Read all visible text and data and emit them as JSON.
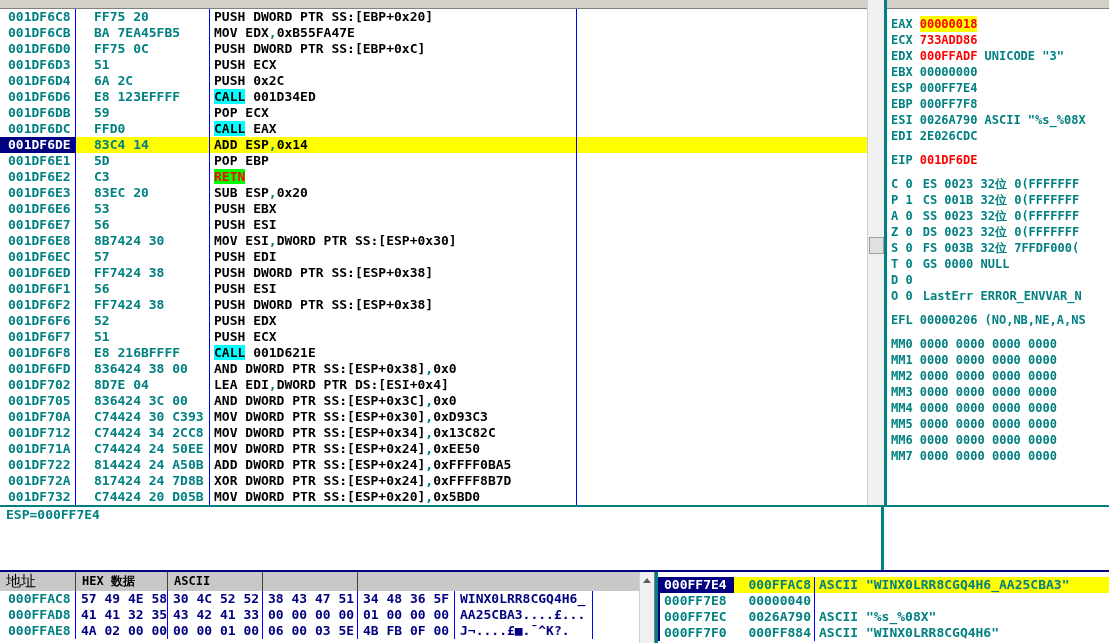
{
  "disasm": {
    "rows": [
      {
        "address": "001DF6C8",
        "hex": "FF75 20",
        "mnemonic": "PUSH",
        "operands": "DWORD PTR SS:[EBP+0x20]",
        "kind": "normal",
        "selected": false
      },
      {
        "address": "001DF6CB",
        "hex": "BA 7EA45FB5",
        "mnemonic": "MOV",
        "operands": "EDX,0xB55FA47E",
        "kind": "normal",
        "selected": false
      },
      {
        "address": "001DF6D0",
        "hex": "FF75 0C",
        "mnemonic": "PUSH",
        "operands": "DWORD PTR SS:[EBP+0xC]",
        "kind": "normal",
        "selected": false
      },
      {
        "address": "001DF6D3",
        "hex": "51",
        "mnemonic": "PUSH",
        "operands": "ECX",
        "kind": "normal",
        "selected": false
      },
      {
        "address": "001DF6D4",
        "hex": "6A 2C",
        "mnemonic": "PUSH",
        "operands": "0x2C",
        "kind": "normal",
        "selected": false
      },
      {
        "address": "001DF6D6",
        "hex": "E8 123EFFFF",
        "mnemonic": "CALL",
        "operands": "001D34ED",
        "kind": "call",
        "selected": false
      },
      {
        "address": "001DF6DB",
        "hex": "59",
        "mnemonic": "POP",
        "operands": "ECX",
        "kind": "normal",
        "selected": false
      },
      {
        "address": "001DF6DC",
        "hex": "FFD0",
        "mnemonic": "CALL",
        "operands": "EAX",
        "kind": "call",
        "selected": false
      },
      {
        "address": "001DF6DE",
        "hex": "83C4 14",
        "mnemonic": "ADD",
        "operands": "ESP,0x14",
        "kind": "normal",
        "selected": true
      },
      {
        "address": "001DF6E1",
        "hex": "5D",
        "mnemonic": "POP",
        "operands": "EBP",
        "kind": "normal",
        "selected": false
      },
      {
        "address": "001DF6E2",
        "hex": "C3",
        "mnemonic": "RETN",
        "kind": "return",
        "selected": false
      },
      {
        "address": "001DF6E3",
        "hex": "83EC 20",
        "mnemonic": "SUB",
        "operands": "ESP,0x20",
        "kind": "normal",
        "selected": false
      },
      {
        "address": "001DF6E6",
        "hex": "53",
        "mnemonic": "PUSH",
        "operands": "EBX",
        "kind": "normal",
        "selected": false
      },
      {
        "address": "001DF6E7",
        "hex": "56",
        "mnemonic": "PUSH",
        "operands": "ESI",
        "kind": "normal",
        "selected": false
      },
      {
        "address": "001DF6E8",
        "hex": "8B7424 30",
        "mnemonic": "MOV",
        "operands": "ESI,DWORD PTR SS:[ESP+0x30]",
        "kind": "normal",
        "selected": false
      },
      {
        "address": "001DF6EC",
        "hex": "57",
        "mnemonic": "PUSH",
        "operands": "EDI",
        "kind": "normal",
        "selected": false
      },
      {
        "address": "001DF6ED",
        "hex": "FF7424 38",
        "mnemonic": "PUSH",
        "operands": "DWORD PTR SS:[ESP+0x38]",
        "kind": "normal",
        "selected": false
      },
      {
        "address": "001DF6F1",
        "hex": "56",
        "mnemonic": "PUSH",
        "operands": "ESI",
        "kind": "normal",
        "selected": false
      },
      {
        "address": "001DF6F2",
        "hex": "FF7424 38",
        "mnemonic": "PUSH",
        "operands": "DWORD PTR SS:[ESP+0x38]",
        "kind": "normal",
        "selected": false
      },
      {
        "address": "001DF6F6",
        "hex": "52",
        "mnemonic": "PUSH",
        "operands": "EDX",
        "kind": "normal",
        "selected": false
      },
      {
        "address": "001DF6F7",
        "hex": "51",
        "mnemonic": "PUSH",
        "operands": "ECX",
        "kind": "normal",
        "selected": false
      },
      {
        "address": "001DF6F8",
        "hex": "E8 216BFFFF",
        "mnemonic": "CALL",
        "operands": "001D621E",
        "kind": "call",
        "selected": false
      },
      {
        "address": "001DF6FD",
        "hex": "836424 38 00",
        "mnemonic": "AND",
        "operands": "DWORD PTR SS:[ESP+0x38],0x0",
        "kind": "normal",
        "selected": false
      },
      {
        "address": "001DF702",
        "hex": "8D7E 04",
        "mnemonic": "LEA",
        "operands": "EDI,DWORD PTR DS:[ESI+0x4]",
        "kind": "normal",
        "selected": false
      },
      {
        "address": "001DF705",
        "hex": "836424 3C 00",
        "mnemonic": "AND",
        "operands": "DWORD PTR SS:[ESP+0x3C],0x0",
        "kind": "normal",
        "selected": false
      },
      {
        "address": "001DF70A",
        "hex": "C74424 30 C393",
        "mnemonic": "MOV",
        "operands": "DWORD PTR SS:[ESP+0x30],0xD93C3",
        "kind": "normal",
        "selected": false
      },
      {
        "address": "001DF712",
        "hex": "C74424 34 2CC8",
        "mnemonic": "MOV",
        "operands": "DWORD PTR SS:[ESP+0x34],0x13C82C",
        "kind": "normal",
        "selected": false
      },
      {
        "address": "001DF71A",
        "hex": "C74424 24 50EE",
        "mnemonic": "MOV",
        "operands": "DWORD PTR SS:[ESP+0x24],0xEE50",
        "kind": "normal",
        "selected": false
      },
      {
        "address": "001DF722",
        "hex": "814424 24 A50B",
        "mnemonic": "ADD",
        "operands": "DWORD PTR SS:[ESP+0x24],0xFFFF0BA5",
        "kind": "normal",
        "selected": false
      },
      {
        "address": "001DF72A",
        "hex": "817424 24 7D8B",
        "mnemonic": "XOR",
        "operands": "DWORD PTR SS:[ESP+0x24],0xFFFF8B7D",
        "kind": "normal",
        "selected": false
      },
      {
        "address": "001DF732",
        "hex": "C74424 20 D05B",
        "mnemonic": "MOV",
        "operands": "DWORD PTR SS:[ESP+0x20],0x5BD0",
        "kind": "normal",
        "selected": false
      }
    ]
  },
  "registers": {
    "general": [
      {
        "name": "EAX",
        "value": "00000018",
        "changed": true,
        "selected": true
      },
      {
        "name": "ECX",
        "value": "733ADD86",
        "changed": true,
        "selected": false
      },
      {
        "name": "EDX",
        "value": "000FFADF",
        "changed": true,
        "selected": false,
        "comment": "UNICODE \"3\""
      },
      {
        "name": "EBX",
        "value": "00000000",
        "changed": false,
        "selected": false
      },
      {
        "name": "ESP",
        "value": "000FF7E4",
        "changed": false,
        "selected": false
      },
      {
        "name": "EBP",
        "value": "000FF7F8",
        "changed": false,
        "selected": false
      },
      {
        "name": "ESI",
        "value": "0026A790",
        "changed": false,
        "selected": false,
        "comment": "ASCII \"%s_%08X"
      },
      {
        "name": "EDI",
        "value": "2E026CDC",
        "changed": false,
        "selected": false
      }
    ],
    "eip": {
      "name": "EIP",
      "value": "001DF6DE",
      "changed": true
    },
    "flags": [
      {
        "flag": "C",
        "value": "0",
        "segment": "ES",
        "selector": "0023",
        "bits": "32位",
        "base": "0(FFFFFFF"
      },
      {
        "flag": "P",
        "value": "1",
        "segment": "CS",
        "selector": "001B",
        "bits": "32位",
        "base": "0(FFFFFFF"
      },
      {
        "flag": "A",
        "value": "0",
        "segment": "SS",
        "selector": "0023",
        "bits": "32位",
        "base": "0(FFFFFFF"
      },
      {
        "flag": "Z",
        "value": "0",
        "segment": "DS",
        "selector": "0023",
        "bits": "32位",
        "base": "0(FFFFFFF"
      },
      {
        "flag": "S",
        "value": "0",
        "segment": "FS",
        "selector": "003B",
        "bits": "32位",
        "base": "7FFDF000("
      },
      {
        "flag": "T",
        "value": "0",
        "segment": "GS",
        "selector": "0000",
        "base": "NULL"
      },
      {
        "flag": "D",
        "value": "0"
      },
      {
        "flag": "O",
        "value": "0",
        "segment": "LastErr",
        "base": "ERROR_ENVVAR_N"
      }
    ],
    "efl": {
      "name": "EFL",
      "value": "00000206",
      "decoded": "(NO,NB,NE,A,NS"
    },
    "mmx": [
      {
        "name": "MM0",
        "value": "0000 0000 0000 0000"
      },
      {
        "name": "MM1",
        "value": "0000 0000 0000 0000"
      },
      {
        "name": "MM2",
        "value": "0000 0000 0000 0000"
      },
      {
        "name": "MM3",
        "value": "0000 0000 0000 0000"
      },
      {
        "name": "MM4",
        "value": "0000 0000 0000 0000"
      },
      {
        "name": "MM5",
        "value": "0000 0000 0000 0000"
      },
      {
        "name": "MM6",
        "value": "0000 0000 0000 0000"
      },
      {
        "name": "MM7",
        "value": "0000 0000 0000 0000"
      }
    ]
  },
  "info": {
    "text": "ESP=000FF7E4"
  },
  "dump": {
    "columns": [
      "地址",
      "HEX 数据",
      "ASCII"
    ],
    "rows": [
      {
        "address": "000FFAC8",
        "groups": [
          "57 49 4E 58",
          "30 4C 52 52",
          "38 43 47 51",
          "34 48 36 5F"
        ],
        "ascii": "WINX0LRR8CGQ4H6_"
      },
      {
        "address": "000FFAD8",
        "groups": [
          "41 41 32 35",
          "43 42 41 33",
          "00 00 00 00",
          "01 00 00 00"
        ],
        "ascii": "AA25CBA3....£..."
      },
      {
        "address": "000FFAE8",
        "groups": [
          "4A 02 00 00",
          "00 00 01 00",
          "06 00 03 5E",
          "4B FB 0F 00"
        ],
        "ascii": "J¬....£■.¯^K?."
      }
    ]
  },
  "stack": {
    "rows": [
      {
        "address": "000FF7E4",
        "value": "000FFAC8",
        "comment": "ASCII \"WINX0LRR8CGQ4H6_AA25CBA3\"",
        "selected": true
      },
      {
        "address": "000FF7E8",
        "value": "00000040",
        "selected": false
      },
      {
        "address": "000FF7EC",
        "value": "0026A790",
        "comment": "ASCII \"%s_%08X\"",
        "selected": false
      },
      {
        "address": "000FF7F0",
        "value": "000FF884",
        "comment": "ASCII \"WINX0LRR8CGQ4H6\"",
        "selected": false
      }
    ]
  }
}
